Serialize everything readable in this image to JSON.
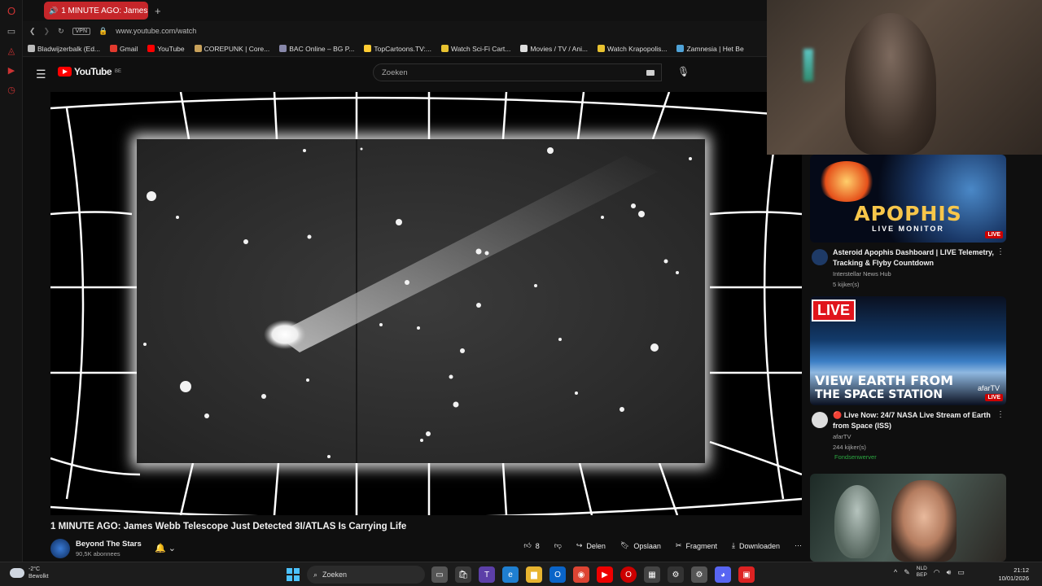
{
  "browser": {
    "tab_title": "1 MINUTE AGO: James",
    "new_tab": "+",
    "vpn_label": "VPN",
    "url": "www.youtube.com/watch",
    "bookmarks": [
      {
        "label": "Bladwijzerbalk (Ed...",
        "color": "#bbbbbb"
      },
      {
        "label": "Gmail",
        "color": "#e23a2e"
      },
      {
        "label": "YouTube",
        "color": "#ff0000"
      },
      {
        "label": "COREPUNK | Core...",
        "color": "#c8a15a"
      },
      {
        "label": "BAC Online – BG P...",
        "color": "#8888aa"
      },
      {
        "label": "TopCartoons.TV:...",
        "color": "#ffcc33"
      },
      {
        "label": "Watch Sci-Fi Cart...",
        "color": "#e8c230"
      },
      {
        "label": "Movies / TV / Ani...",
        "color": "#dddddd"
      },
      {
        "label": "Watch Krapopolis...",
        "color": "#e8c230"
      },
      {
        "label": "Zamnesia | Het Be",
        "color": "#4fa3d8"
      }
    ]
  },
  "youtube": {
    "logo_text": "YouTube",
    "region": "BE",
    "search_placeholder": "Zoeken"
  },
  "video": {
    "title": "1 MINUTE AGO: James Webb Telescope Just Detected 3I/ATLAS Is Carrying Life",
    "channel": "Beyond The Stars",
    "subscribers": "90,5K abonnees",
    "likes": "8",
    "actions": {
      "share": "Delen",
      "save": "Opslaan",
      "clip": "Fragment",
      "download": "Downloaden"
    }
  },
  "recommended": [
    {
      "thumb_big": "APOPHIS",
      "thumb_small": "LIVE MONITOR",
      "thumb_badge": "LIVE",
      "title": "Asteroid Apophis Dashboard | LIVE Telemetry, Tracking & Flyby Countdown",
      "channel": "Interstellar News Hub",
      "viewers": "5 kijker(s)"
    },
    {
      "thumb_live": "LIVE",
      "thumb_line1": "VIEW EARTH FROM",
      "thumb_line2": "THE SPACE STATION",
      "thumb_brand": "afarTV",
      "thumb_badge": "LIVE",
      "title": "🔴 Live Now: 24/7 NASA Live Stream of Earth from Space (ISS)",
      "channel": "afarTV",
      "viewers": "244 kijker(s)",
      "fundraiser": "Fondsenwerver"
    },
    {
      "title": ""
    }
  ],
  "taskbar": {
    "temp": "-2°C",
    "weather": "Bewolkt",
    "search": "Zoeken",
    "lang1": "NLD",
    "lang2": "BEP",
    "time": "21:12",
    "date": "10/01/2026"
  },
  "colors": {
    "accent": "#ff0000",
    "tab": "#c5262a",
    "bg": "#0f0f0f"
  }
}
